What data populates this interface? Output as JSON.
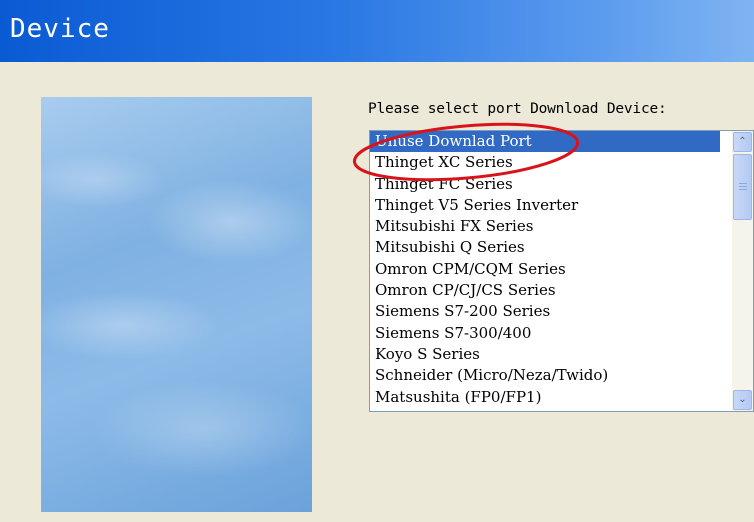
{
  "window": {
    "title": "Device"
  },
  "colors": {
    "title_bar": "#0A5AD4",
    "selection": "#316AC5",
    "annotation": "#D8141A"
  },
  "device_select": {
    "prompt": "Please select port Download Device:",
    "selected_index": 0,
    "items": [
      "Unuse Downlad Port",
      "Thinget XC Series",
      "Thinget FC Series",
      "Thinget V5 Series Inverter",
      "Mitsubishi FX Series",
      "Mitsubishi Q Series",
      "Omron CPM/CQM Series",
      "Omron CP/CJ/CS Series",
      "Siemens S7-200 Series",
      "Siemens S7-300/400",
      "Koyo S Series",
      "Schneider (Micro/Neza/Twido)",
      "Matsushita (FP0/FP1)"
    ]
  },
  "icons": {
    "scroll_up": "chevron-up-icon",
    "scroll_down": "chevron-down-icon",
    "scroll_up_glyph": "⌃",
    "scroll_down_glyph": "⌄"
  }
}
